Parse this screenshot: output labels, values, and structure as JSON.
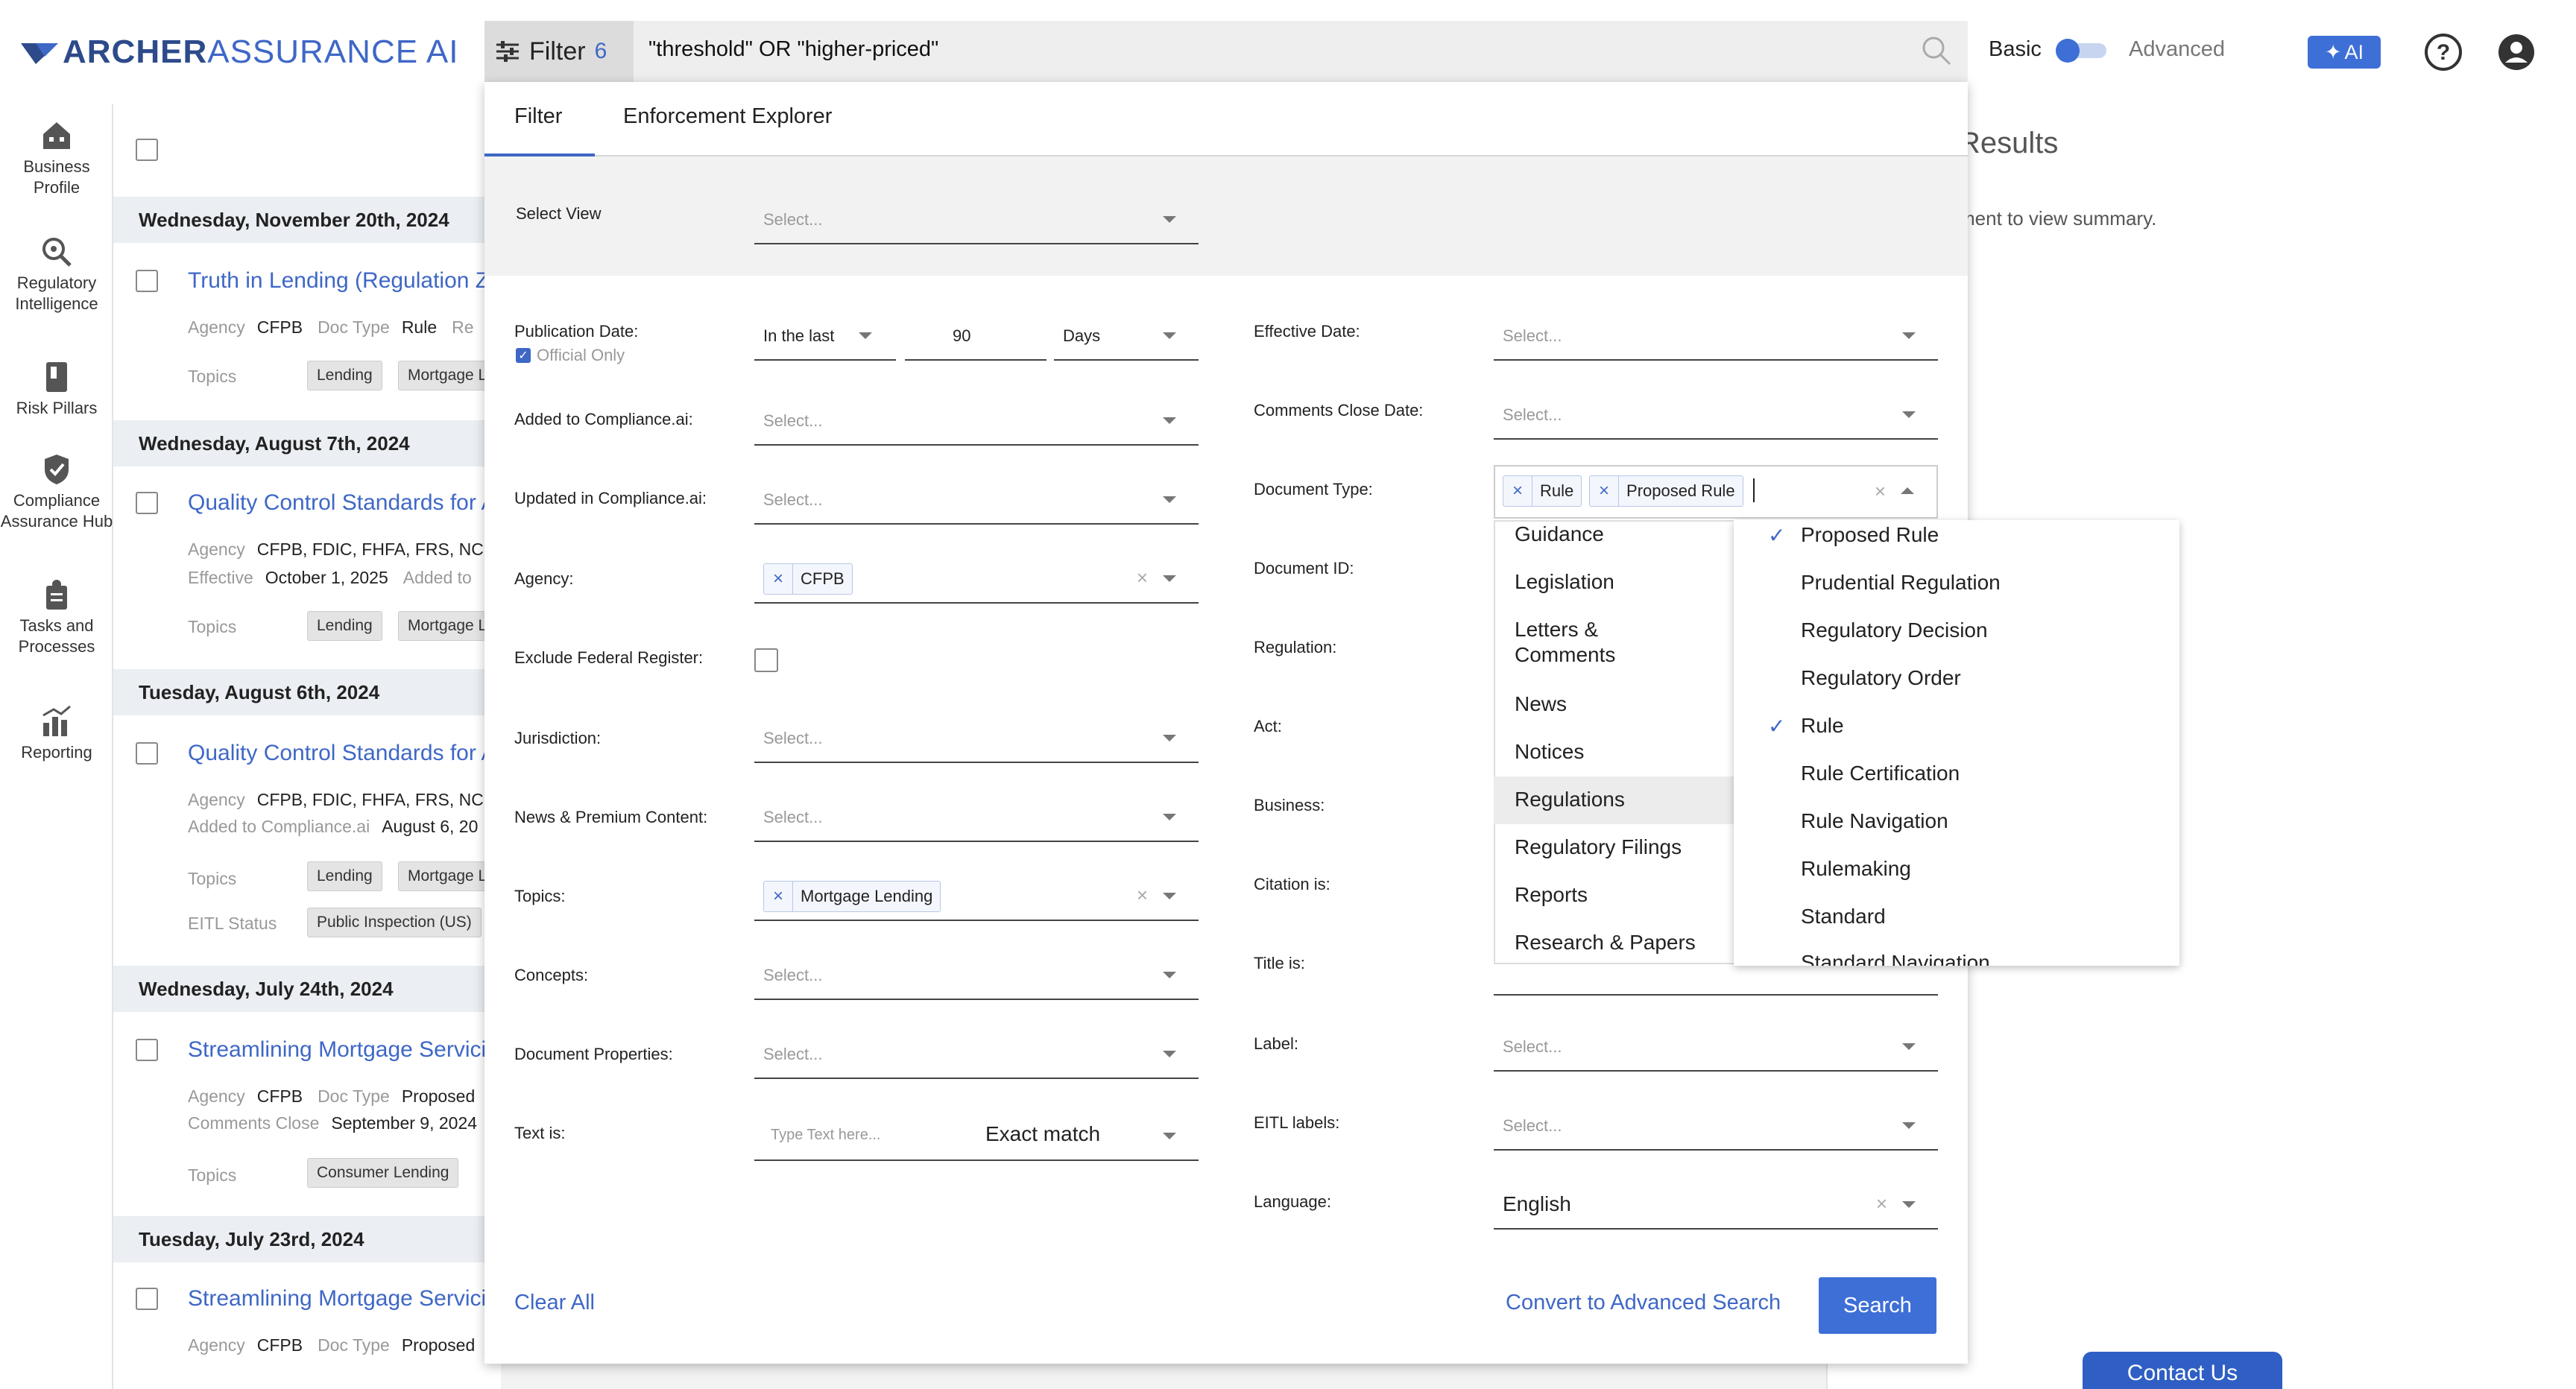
{
  "brand": {
    "name_bold": "ARCHER",
    "name_light": "ASSURANCE AI"
  },
  "topbar": {
    "filter_label": "Filter",
    "filter_count": "6",
    "query": "\"threshold\" OR \"higher-priced\"",
    "mode_basic": "Basic",
    "mode_advanced": "Advanced",
    "ai_label": "AI"
  },
  "leftnav": [
    {
      "label": "Business Profile",
      "icon": "building-icon"
    },
    {
      "label": "Regulatory Intelligence",
      "icon": "magnify-icon"
    },
    {
      "label": "Risk Pillars",
      "icon": "pillar-icon"
    },
    {
      "label": "Compliance Assurance Hub",
      "icon": "shield-check-icon"
    },
    {
      "label": "Tasks and Processes",
      "icon": "tasks-icon"
    },
    {
      "label": "Reporting",
      "icon": "chart-icon"
    }
  ],
  "results_list": {
    "groups": [
      {
        "date": "Wednesday, November 20th, 2024",
        "title": "Truth in Lending (Regulation Z)",
        "meta1": [
          [
            "Agency",
            "CFPB"
          ],
          [
            "Doc Type",
            "Rule"
          ],
          [
            "Re",
            ""
          ]
        ],
        "topics": [
          "Lending",
          "Mortgage L"
        ]
      },
      {
        "date": "Wednesday, August 7th, 2024",
        "title": "Quality Control Standards for A",
        "meta1": [
          [
            "Agency",
            "CFPB, FDIC, FHFA, FRS, NCU"
          ]
        ],
        "meta2": [
          [
            "Effective",
            "October 1, 2025"
          ],
          [
            "Added to",
            ""
          ]
        ],
        "topics": [
          "Lending",
          "Mortgage L"
        ]
      },
      {
        "date": "Tuesday, August 6th, 2024",
        "title": "Quality Control Standards for A",
        "meta1": [
          [
            "Agency",
            "CFPB, FDIC, FHFA, FRS, NCU"
          ]
        ],
        "meta2": [
          [
            "Added to Compliance.ai",
            "August 6, 20"
          ]
        ],
        "topics": [
          "Lending",
          "Mortgage L"
        ],
        "eitl": "Public Inspection (US)"
      },
      {
        "date": "Wednesday, July 24th, 2024",
        "title": "Streamlining Mortgage Servici",
        "meta1": [
          [
            "Agency",
            "CFPB"
          ],
          [
            "Doc Type",
            "Proposed"
          ]
        ],
        "meta2": [
          [
            "Comments Close",
            "September 9, 2024"
          ]
        ],
        "topics": [
          "Consumer Lending"
        ]
      },
      {
        "date": "Tuesday, July 23rd, 2024",
        "title": "Streamlining Mortgage Servici",
        "meta1": [
          [
            "Agency",
            "CFPB"
          ],
          [
            "Doc Type",
            "Proposed"
          ]
        ]
      }
    ],
    "labels": {
      "topics": "Topics",
      "eitl_status": "EITL Status"
    }
  },
  "results_panel": {
    "title": "Results",
    "subtitle": "ment to view summary."
  },
  "contact_us": "Contact Us",
  "modal": {
    "tabs": [
      "Filter",
      "Enforcement Explorer"
    ],
    "select_view": {
      "label": "Select View",
      "placeholder": "Select..."
    },
    "left_fields": {
      "publication_date": {
        "label": "Publication Date:",
        "op": "In the last",
        "num": "90",
        "unit": "Days",
        "official_only": "Official Only"
      },
      "added": {
        "label": "Added to Compliance.ai:",
        "placeholder": "Select..."
      },
      "updated": {
        "label": "Updated in Compliance.ai:",
        "placeholder": "Select..."
      },
      "agency": {
        "label": "Agency:",
        "chip": "CFPB"
      },
      "exclude_fr": {
        "label": "Exclude Federal Register:"
      },
      "jurisdiction": {
        "label": "Jurisdiction:",
        "placeholder": "Select..."
      },
      "news": {
        "label": "News & Premium Content:",
        "placeholder": "Select..."
      },
      "topics": {
        "label": "Topics:",
        "chip": "Mortgage Lending"
      },
      "concepts": {
        "label": "Concepts:",
        "placeholder": "Select..."
      },
      "doc_props": {
        "label": "Document Properties:",
        "placeholder": "Select..."
      },
      "text_is": {
        "label": "Text is:",
        "placeholder": "Type Text here...",
        "mode": "Exact match"
      }
    },
    "right_fields": {
      "effective_date": {
        "label": "Effective Date:",
        "placeholder": "Select..."
      },
      "comments_close": {
        "label": "Comments Close Date:",
        "placeholder": "Select..."
      },
      "doc_type": {
        "label": "Document Type:",
        "chips": [
          "Rule",
          "Proposed Rule"
        ]
      },
      "doc_id": {
        "label": "Document ID:"
      },
      "regulation": {
        "label": "Regulation:"
      },
      "act": {
        "label": "Act:"
      },
      "business": {
        "label": "Business:"
      },
      "citation": {
        "label": "Citation is:"
      },
      "title": {
        "label": "Title is:"
      },
      "label": {
        "label": "Label:",
        "placeholder": "Select..."
      },
      "eitl": {
        "label": "EITL labels:",
        "placeholder": "Select..."
      },
      "language": {
        "label": "Language:",
        "value": "English"
      }
    },
    "clear_all": "Clear All",
    "convert": "Convert to Advanced Search",
    "search": "Search"
  },
  "doctype_dropdown": {
    "categories": [
      "Guidance",
      "Legislation",
      "Letters & Comments",
      "News",
      "Notices",
      "Regulations",
      "Regulatory Filings",
      "Reports",
      "Research & Papers"
    ],
    "highlighted_category": "Regulations",
    "options": [
      {
        "label": "Proposed Rule",
        "checked": true
      },
      {
        "label": "Prudential Regulation",
        "checked": false
      },
      {
        "label": "Regulatory Decision",
        "checked": false
      },
      {
        "label": "Regulatory Order",
        "checked": false
      },
      {
        "label": "Rule",
        "checked": true
      },
      {
        "label": "Rule Certification",
        "checked": false
      },
      {
        "label": "Rule Navigation",
        "checked": false
      },
      {
        "label": "Rulemaking",
        "checked": false
      },
      {
        "label": "Standard",
        "checked": false
      },
      {
        "label": "Standard Navigation",
        "checked": false
      }
    ]
  },
  "colors": {
    "accent": "#3e67c6",
    "button": "#3e6fd6",
    "brand": "#2d4a8a"
  }
}
